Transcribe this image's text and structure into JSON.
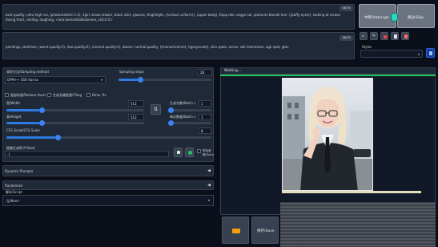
{
  "prompt": {
    "positive": "best quality, ultra high res, (photorealistic:1.4), 1girl, brown blazer, black skirt, glasses, thighhighs, ((school uniform)), (upper body), Kpop idol, aegyo sal, platinum blonde hair, ((puffy eyes)), looking at viewer, facing front, smiling, laughing, <lora:koreanDollLikeness_v10:0.5>",
    "positive_counter": "58/75",
    "negative": "paintings, sketches, (worst quality:2), (low quality:2), (normal quality:2), lowres, normal quality, ((monochrome)), ((grayscale)), skin spots, acnes, skin blemishes, age spot, glan",
    "negative_counter": "38/75"
  },
  "actions": {
    "interrupt_label": "中断/Interrupt",
    "skip_label": "跳过/Skip",
    "styles_label": "Styles",
    "tool_icons": [
      "arrow-icon",
      "trash-icon",
      "stop-icon",
      "clipboard-icon",
      "save-icon"
    ]
  },
  "settings": {
    "sampling_method_label": "采样方法/Sampling method",
    "sampling_method_value": "DPM++ SDE Karras",
    "sampling_steps_label": "Sampling steps",
    "sampling_steps_value": "28",
    "restore_faces_label": "面部修复/Restore faces",
    "tiling_label": "生成无缝贴图/Tiling",
    "hires_fix_label": "Hires. fix",
    "width_label": "宽/Width",
    "width_value": "512",
    "height_label": "高/Height",
    "height_value": "512",
    "swap_label": "⇅",
    "batch_count_label": "生成次数/Batch c",
    "batch_count_value": "1",
    "batch_size_label": "每次数量/Batch s",
    "batch_size_value": "1",
    "cfg_label": "CFG Scale/CFG Scale",
    "cfg_value": "8",
    "seed_label": "图像生成种子/Seed",
    "seed_value": "-1",
    "extra_label_1": "附加参",
    "extra_label_2": "数/Extra"
  },
  "accordions": {
    "dynamic_prompts": "Dynamic Prompts",
    "randomize": "Randomize",
    "script_label": "脚本/Script",
    "script_value": "无/None"
  },
  "output": {
    "status": "Waiting...",
    "save_label": "保存/Save"
  }
}
